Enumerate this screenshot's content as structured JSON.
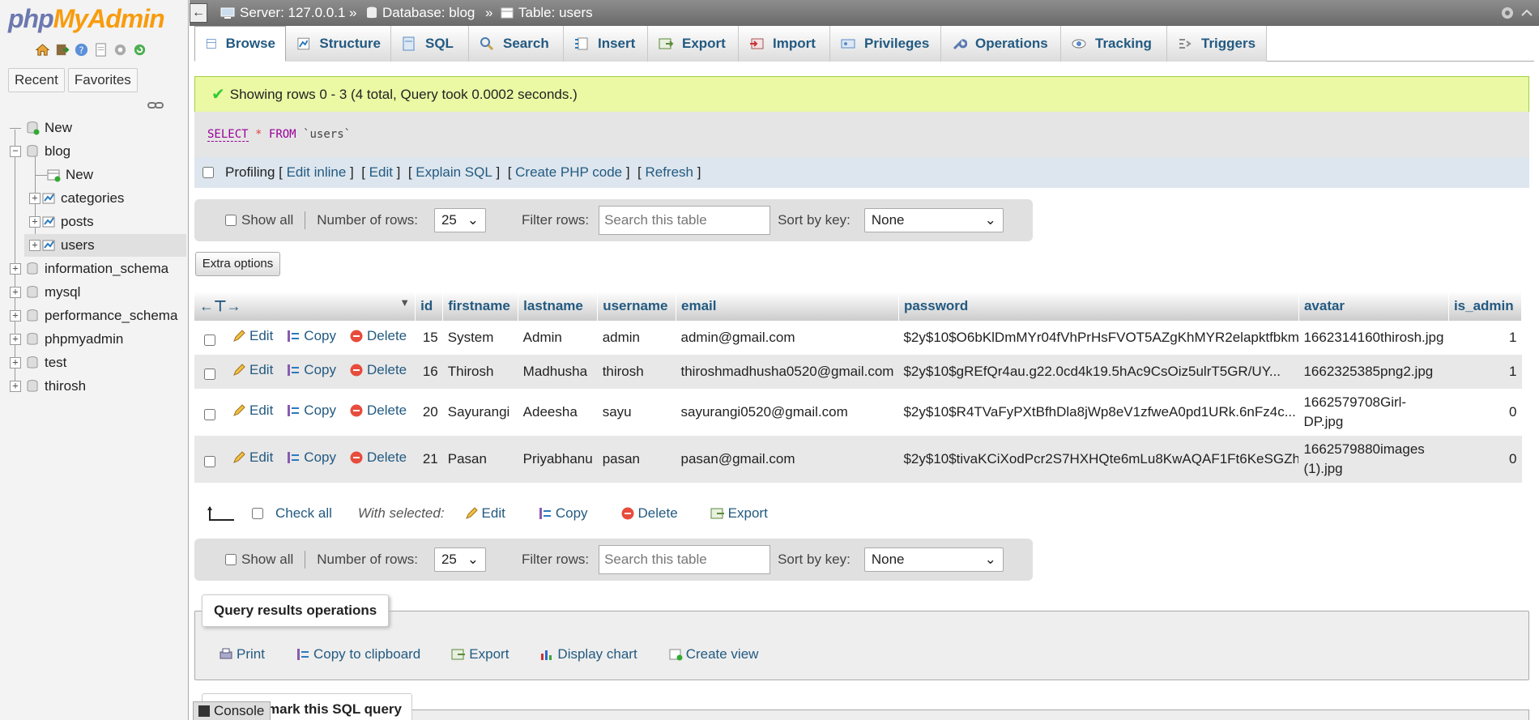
{
  "app": {
    "logo_part1": "php",
    "logo_part2": "MyAdmin"
  },
  "sidebar": {
    "nav_icons": [
      "home-icon",
      "logout-icon",
      "help-icon",
      "docs-icon",
      "settings-icon",
      "reload-icon"
    ],
    "tabs": [
      "Recent",
      "Favorites"
    ],
    "tree": [
      {
        "label": "New",
        "icon": "new-db-icon",
        "level": 0
      },
      {
        "label": "blog",
        "icon": "database-icon",
        "level": 0,
        "expanded": true
      },
      {
        "label": "New",
        "icon": "new-table-icon",
        "level": 1
      },
      {
        "label": "categories",
        "icon": "table-icon",
        "level": 1
      },
      {
        "label": "posts",
        "icon": "table-icon",
        "level": 1
      },
      {
        "label": "users",
        "icon": "table-icon",
        "level": 1,
        "active": true
      },
      {
        "label": "information_schema",
        "icon": "database-icon",
        "level": 0
      },
      {
        "label": "mysql",
        "icon": "database-icon",
        "level": 0
      },
      {
        "label": "performance_schema",
        "icon": "database-icon",
        "level": 0
      },
      {
        "label": "phpmyadmin",
        "icon": "database-icon",
        "level": 0
      },
      {
        "label": "test",
        "icon": "database-icon",
        "level": 0
      },
      {
        "label": "thirosh",
        "icon": "database-icon",
        "level": 0
      }
    ]
  },
  "topbar": {
    "collapse": "←",
    "server_label": "Server: 127.0.0.1",
    "database_label": "Database: blog",
    "table_label": "Table: users",
    "separator": "»"
  },
  "tabs": [
    "Browse",
    "Structure",
    "SQL",
    "Search",
    "Insert",
    "Export",
    "Import",
    "Privileges",
    "Operations",
    "Tracking",
    "Triggers"
  ],
  "success": {
    "message": "Showing rows 0 - 3 (4 total, Query took 0.0002 seconds.)"
  },
  "sql": {
    "kw1": "SELECT",
    "star": "*",
    "kw2": "FROM",
    "table": "`users`"
  },
  "profiling": {
    "label": "Profiling",
    "links": [
      "Edit inline",
      "Edit",
      "Explain SQL",
      "Create PHP code",
      "Refresh"
    ]
  },
  "navbar": {
    "show_all": "Show all",
    "rows_label": "Number of rows:",
    "rows_value": "25",
    "filter_label": "Filter rows:",
    "filter_placeholder": "Search this table",
    "sort_label": "Sort by key:",
    "sort_value": "None"
  },
  "extra_options": "Extra options",
  "table": {
    "columns": [
      "id",
      "firstname",
      "lastname",
      "username",
      "email",
      "password",
      "avatar",
      "is_admin"
    ],
    "actions": {
      "edit": "Edit",
      "copy": "Copy",
      "delete": "Delete"
    },
    "rows": [
      {
        "id": "15",
        "firstname": "System",
        "lastname": "Admin",
        "username": "admin",
        "email": "admin@gmail.com",
        "password": "$2y$10$O6bKlDmMYr04fVhPrHsFVOT5AZgKhMYR2elapktfbkm...",
        "avatar": [
          "1662314160thirosh.jpg"
        ],
        "is_admin": "1"
      },
      {
        "id": "16",
        "firstname": "Thirosh",
        "lastname": "Madhusha",
        "username": "thirosh",
        "email": "thiroshmadhusha0520@gmail.com",
        "password": "$2y$10$gREfQr4au.g22.0cd4k19.5hAc9CsOiz5ulrT5GR/UY...",
        "avatar": [
          "1662325385png2.jpg"
        ],
        "is_admin": "1"
      },
      {
        "id": "20",
        "firstname": "Sayurangi",
        "lastname": "Adeesha",
        "username": "sayu",
        "email": "sayurangi0520@gmail.com",
        "password": "$2y$10$R4TVaFyPXtBfhDla8jWp8eV1zfweA0pd1URk.6nFz4c...",
        "avatar": [
          "1662579708Girl-",
          "DP.jpg"
        ],
        "is_admin": "0"
      },
      {
        "id": "21",
        "firstname": "Pasan",
        "lastname": "Priyabhanu",
        "username": "pasan",
        "email": "pasan@gmail.com",
        "password": "$2y$10$tivaKCiXodPcr2S7HXHQte6mLu8KwAQAF1Ft6KeSGZh...",
        "avatar": [
          "1662579880images",
          "(1).jpg"
        ],
        "is_admin": "0"
      }
    ]
  },
  "with_selected": {
    "check_all": "Check all",
    "label": "With selected:",
    "edit": "Edit",
    "copy": "Copy",
    "delete": "Delete",
    "export": "Export"
  },
  "query_ops": {
    "legend": "Query results operations",
    "links": [
      "Print",
      "Copy to clipboard",
      "Export",
      "Display chart",
      "Create view"
    ]
  },
  "bookmark": {
    "legend_visible": "mark this SQL query"
  },
  "console": {
    "label": "Console"
  },
  "colors": {
    "link": "#235a81",
    "success_bg": "#ebf8a4",
    "sql_keyword": "#990099",
    "delete_red": "#e74c3c"
  }
}
